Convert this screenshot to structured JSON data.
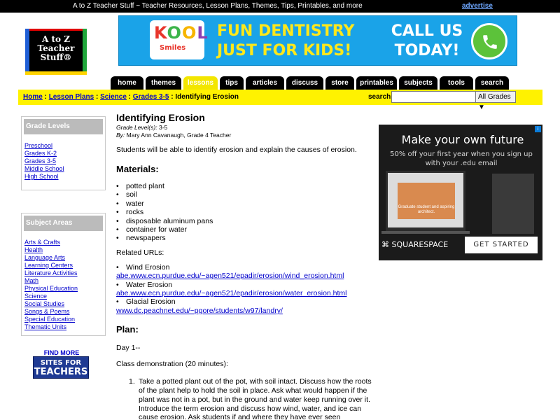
{
  "topbar": {
    "tagline": "A to Z Teacher Stuff ~ Teacher Resources, Lesson Plans, Themes, Tips, Printables, and more",
    "advertise": "advertise"
  },
  "logo": {
    "text": "A to Z Teacher Stuff®"
  },
  "banner_ad": {
    "brand": "KOOL",
    "brand_sub": "Smiles",
    "headline_1": "FUN DENTISTRY",
    "headline_2": "JUST FOR KIDS!",
    "cta_1": "CALL US",
    "cta_2": "TODAY!",
    "icon": "phone-icon"
  },
  "nav": {
    "tabs": [
      {
        "label": "home",
        "w": 0
      },
      {
        "label": "themes"
      },
      {
        "label": "lessons",
        "active": true
      },
      {
        "label": "tips"
      },
      {
        "label": "articles"
      },
      {
        "label": "discuss"
      },
      {
        "label": "store"
      },
      {
        "label": "printables"
      },
      {
        "label": "subjects"
      },
      {
        "label": "tools"
      },
      {
        "label": "search"
      }
    ]
  },
  "breadcrumb": {
    "items": [
      "Home",
      "Lesson Plans",
      "Science",
      "Grades 3-5"
    ],
    "separator": ":",
    "current": "Identifying Erosion"
  },
  "search": {
    "label": "search:",
    "value": "",
    "grade_selected": "All Grades"
  },
  "sidebar": {
    "grade_levels": {
      "title": "Grade Levels",
      "items": [
        "Preschool",
        "Grades K-2",
        "Grades 3-5",
        "Middle School",
        "High School"
      ]
    },
    "subject_areas": {
      "title": "Subject Areas",
      "items": [
        "Arts & Crafts",
        "Health",
        "Language Arts",
        "Learning Centers",
        "Literature Activities",
        "Math",
        "Physical Education",
        "Science",
        "Social Studies",
        "Songs & Poems",
        "Special Education",
        "Thematic Units"
      ]
    },
    "find_more": "FIND MORE",
    "sites_button": {
      "line1": "SITES FOR",
      "line2": "TEACHERS"
    }
  },
  "lesson": {
    "title": "Identifying Erosion",
    "grade_label": "Grade Level(s):",
    "grade_value": "3-5",
    "by_label": "By:",
    "by_value": "Mary Ann Cavanaugh, Grade 4 Teacher",
    "objective": "Students will be able to identify erosion and explain the causes of erosion.",
    "materials_heading": "Materials:",
    "materials": [
      "potted plant",
      "soil",
      "water",
      "rocks",
      "disposable aluminum pans",
      "container for water",
      "newspapers"
    ],
    "related_heading": "Related URLs:",
    "related": [
      {
        "name": "Wind Erosion",
        "url": "abe.www.ecn.purdue.edu/~agen521/epadir/erosion/wind_erosion.html"
      },
      {
        "name": "Water Erosion",
        "url": "abe.www.ecn.purdue.edu/~agen521/epadir/erosion/water_erosion.html"
      },
      {
        "name": "Glacial Erosion",
        "url": "www.dc.peachnet.edu/~pgore/students/w97/landry/"
      }
    ],
    "plan_heading": "Plan:",
    "day": "Day 1--",
    "demo": "Class demonstration (20 minutes):",
    "steps": [
      {
        "num": "1.",
        "text": "Take a potted plant out of the pot, with soil intact. Discuss how the roots of the plant help to hold the soil in place. Ask what would happen if the plant was not in a pot, but in the ground and water keep running over it. Introduce the term erosion and discuss how wind, water, and ice can cause erosion. Ask students if and where they have ever seen"
      }
    ]
  },
  "right_ad": {
    "headline": "Make your own future",
    "sub": "50% off your first year when you sign up with your .edu email",
    "laptop_caption": "Graduate student and aspiring architect.",
    "brand": "SQUARESPACE",
    "button": "GET STARTED",
    "info_icon": "i"
  }
}
